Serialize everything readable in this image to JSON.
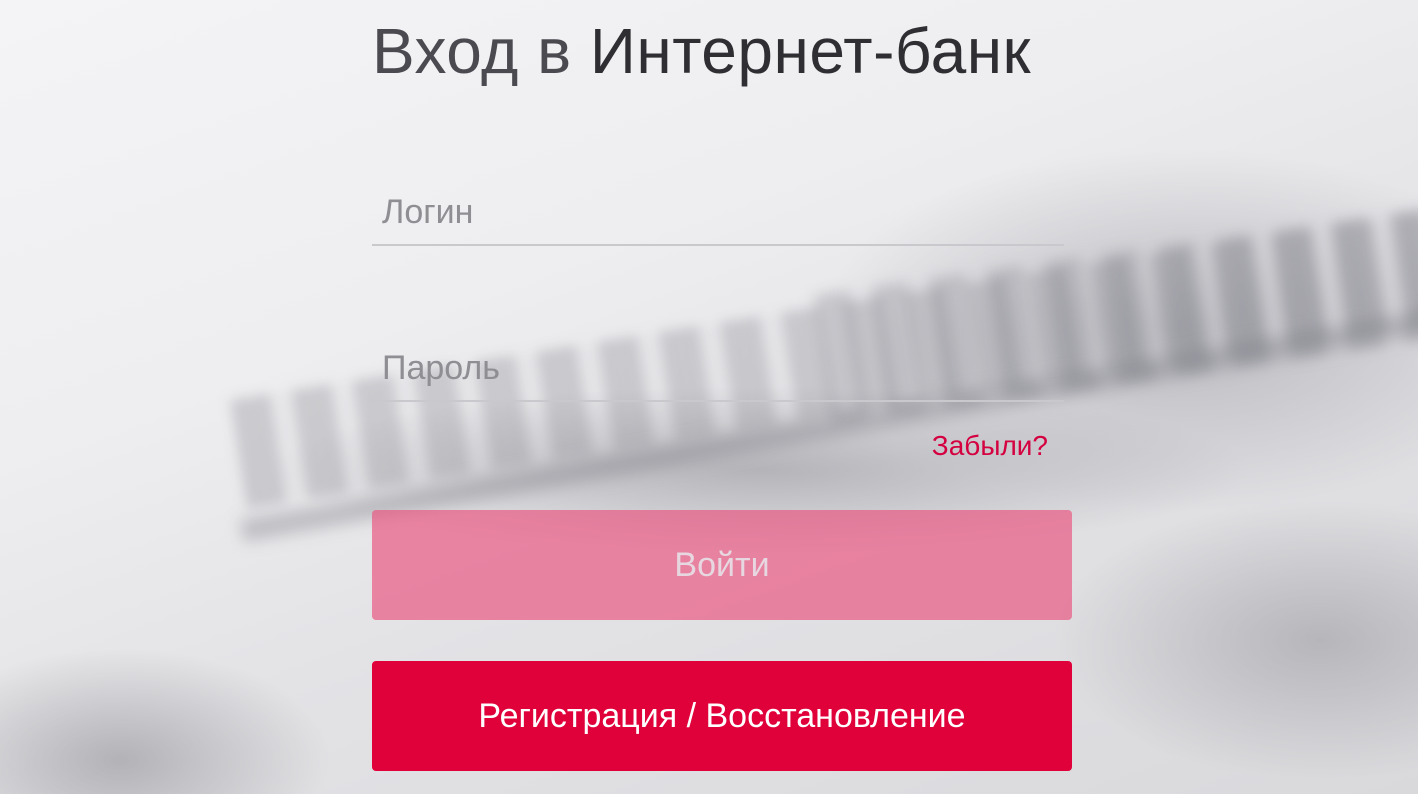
{
  "header": {
    "title_prefix": "Вход в",
    "title_main": "Интернет-банк"
  },
  "form": {
    "login": {
      "placeholder": "Логин",
      "value": ""
    },
    "password": {
      "placeholder": "Пароль",
      "value": ""
    },
    "forgot_link": "Забыли?",
    "submit_label": "Войти",
    "register_label": "Регистрация / Восстановление"
  },
  "colors": {
    "accent": "#e0003a",
    "link": "#d4003f",
    "submit_disabled": "#ea5480"
  }
}
